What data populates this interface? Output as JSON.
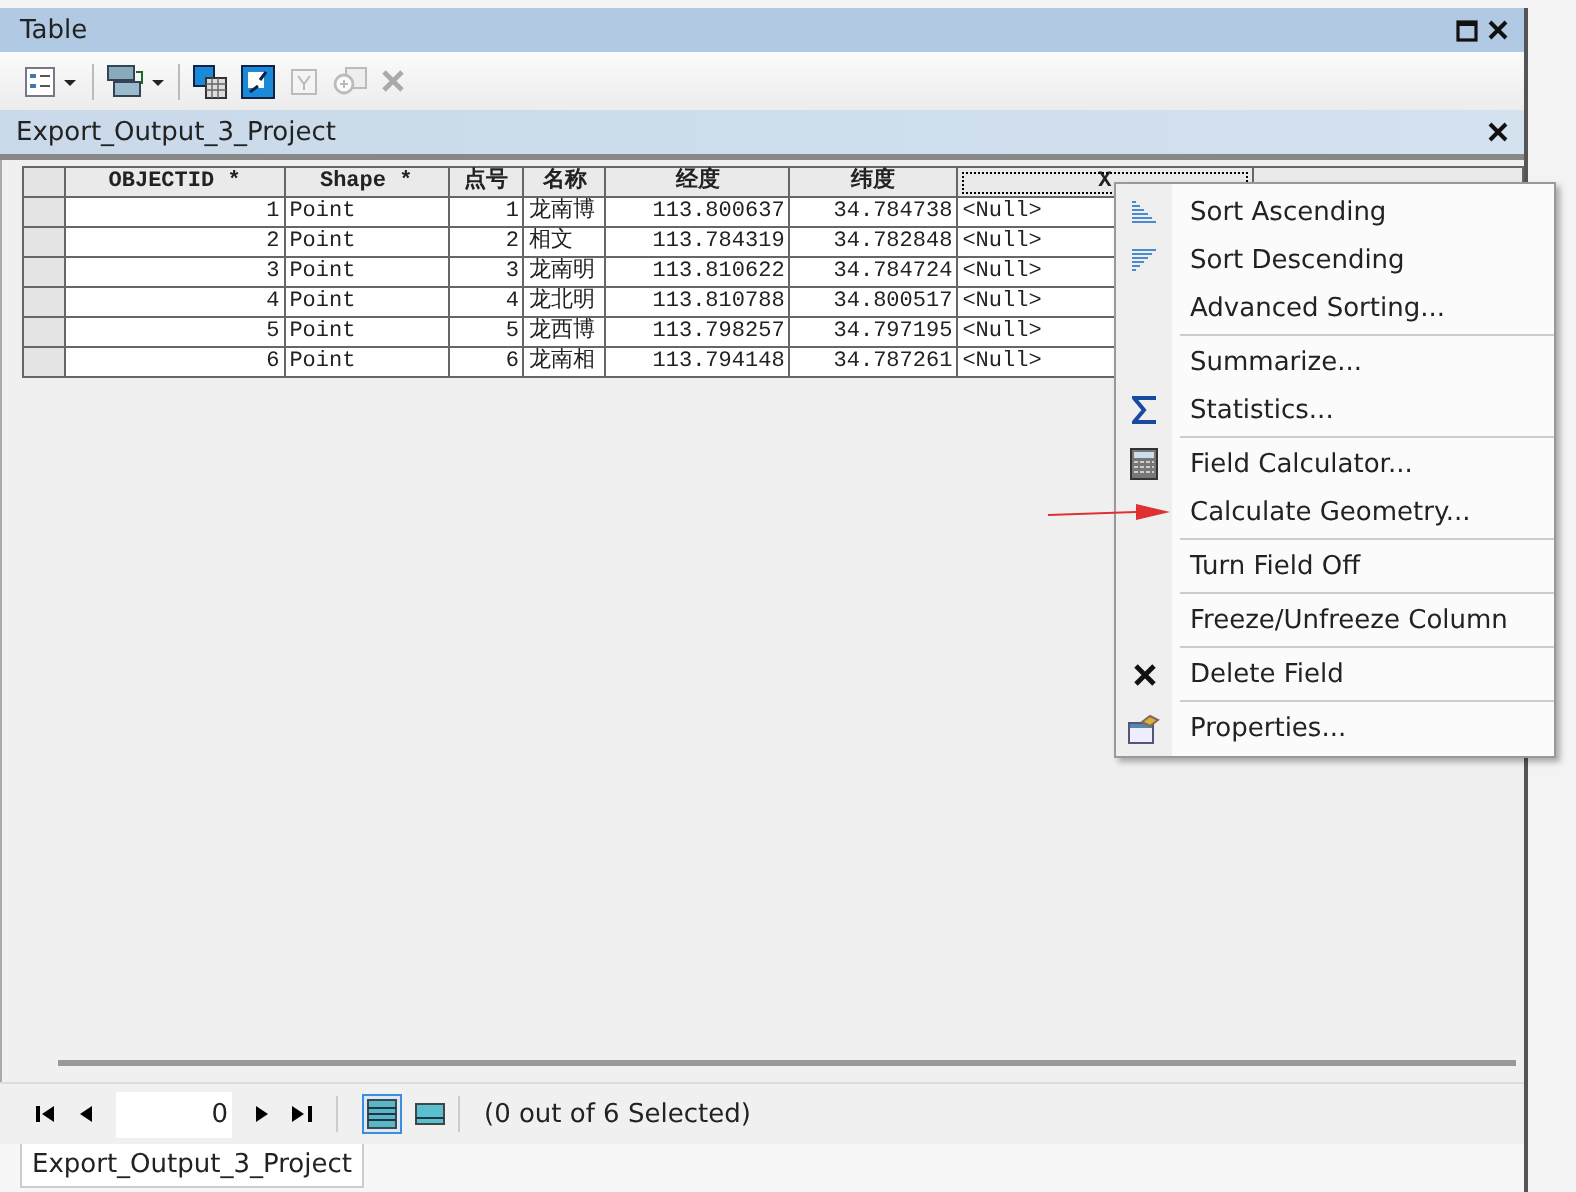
{
  "window": {
    "title": "Table"
  },
  "table_tab": {
    "title": "Export_Output_3_Project"
  },
  "columns": [
    {
      "label": "OBJECTID *",
      "selected": false
    },
    {
      "label": "Shape *",
      "selected": false
    },
    {
      "label": "点号",
      "selected": false
    },
    {
      "label": "名称",
      "selected": false
    },
    {
      "label": "经度",
      "selected": false
    },
    {
      "label": "纬度",
      "selected": false
    },
    {
      "label": "X",
      "selected": true
    },
    {
      "selected": false
    }
  ],
  "rows": [
    [
      "1",
      "Point",
      "1",
      "龙南博",
      "113.800637",
      "34.784738",
      "<Null>"
    ],
    [
      "2",
      "Point",
      "2",
      "相文",
      "113.784319",
      "34.782848",
      "<Null>"
    ],
    [
      "3",
      "Point",
      "3",
      "龙南明",
      "113.810622",
      "34.784724",
      "<Null>"
    ],
    [
      "4",
      "Point",
      "4",
      "龙北明",
      "113.810788",
      "34.800517",
      "<Null>"
    ],
    [
      "5",
      "Point",
      "5",
      "龙西博",
      "113.798257",
      "34.797195",
      "<Null>"
    ],
    [
      "6",
      "Point",
      "6",
      "龙南相",
      "113.794148",
      "34.787261",
      "<Null>"
    ]
  ],
  "context_menu": {
    "groups": [
      [
        "Sort Ascending",
        "Sort Descending",
        "Advanced Sorting..."
      ],
      [
        "Summarize...",
        "Statistics..."
      ],
      [
        "Field Calculator...",
        "Calculate Geometry..."
      ],
      [
        "Turn Field Off"
      ],
      [
        "Freeze/Unfreeze Column"
      ],
      [
        "Delete Field"
      ],
      [
        "Properties..."
      ]
    ]
  },
  "navigation": {
    "record": "0",
    "views": [
      {
        "kind": "all",
        "selected": true
      },
      {
        "kind": "selected",
        "selected": false
      }
    ],
    "status": "(0 out of 6 Selected)"
  },
  "bottom_tab": {
    "label": "Export_Output_3_Project"
  }
}
